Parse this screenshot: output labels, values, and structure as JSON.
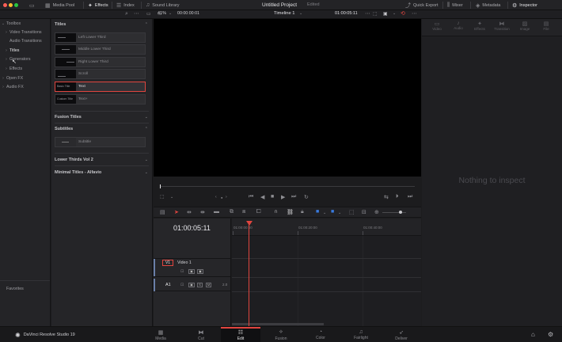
{
  "topbar": {
    "media_pool": "Media Pool",
    "effects": "Effects",
    "index": "Index",
    "sound_library": "Sound Library",
    "project_title": "Untitled Project",
    "project_state": "Edited",
    "quick_export": "Quick Export",
    "mixer": "Mixer",
    "metadata": "Metadata",
    "inspector": "Inspector"
  },
  "viewer": {
    "zoom": "41%",
    "source_timecode": "00:00:00:01",
    "timeline_name": "Timeline 1",
    "record_timecode": "01:00:05:11"
  },
  "effects_tree": {
    "items": [
      {
        "label": "Toolbox",
        "chevron": "⌄"
      },
      {
        "label": "Video Transitions",
        "chevron": "›"
      },
      {
        "label": "Audio Transitions",
        "chevron": ""
      },
      {
        "label": "Titles",
        "chevron": "›"
      },
      {
        "label": "Generators",
        "chevron": "›"
      },
      {
        "label": "Effects",
        "chevron": "›"
      },
      {
        "label": "Open FX",
        "chevron": "›"
      },
      {
        "label": "Audio FX",
        "chevron": "›"
      }
    ],
    "favorites": "Favorites"
  },
  "effects_list": {
    "titles_header": "Titles",
    "titles": [
      {
        "label": "Left Lower Third"
      },
      {
        "label": "Middle Lower Third"
      },
      {
        "label": "Right Lower Third"
      },
      {
        "label": "Scroll"
      },
      {
        "label": "Text",
        "thumb": "Basic Title"
      },
      {
        "label": "Text+",
        "thumb": "Custom Title"
      }
    ],
    "fusion_titles_header": "Fusion Titles",
    "subtitles_header": "Subtitles",
    "subtitle_item": "Subtitle",
    "lower_thirds_header": "Lower Thirds Vol 2",
    "minimal_titles_header": "Minimal Titles - Alfavio"
  },
  "timeline": {
    "timecode": "01:00:05:11",
    "ruler": [
      "01:00:00:00",
      "01:00:20:00",
      "01:00:40:00"
    ],
    "video_track_id": "V1",
    "video_track_name": "Video 1",
    "audio_track_id": "A1",
    "audio_track_level": "2.0"
  },
  "inspector": {
    "tabs": [
      "Video",
      "Audio",
      "Effects",
      "Transition",
      "Image",
      "File"
    ],
    "empty_message": "Nothing to inspect"
  },
  "pages": [
    "Media",
    "Cut",
    "Edit",
    "Fusion",
    "Color",
    "Fairlight",
    "Deliver"
  ],
  "brand": "DaVinci Resolve Studio 19",
  "colors": {
    "accent": "#e0453f",
    "selection": "#e0453f"
  }
}
